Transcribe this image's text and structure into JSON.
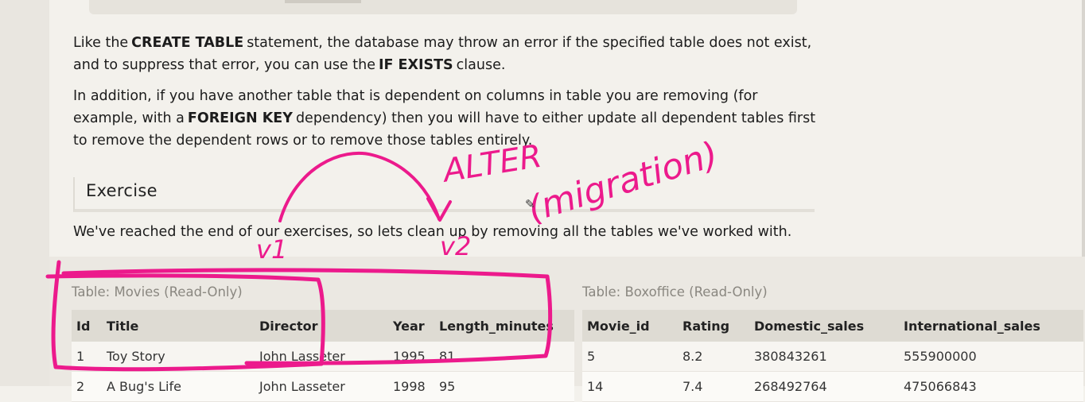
{
  "paragraph1": {
    "t1": "Like the",
    "k1": "CREATE TABLE",
    "t2": "statement, the database may throw an error if the specified table does not exist, and to suppress that error, you can use the",
    "k2": "IF EXISTS",
    "t3": "clause."
  },
  "paragraph2": {
    "t1": "In addition, if you have another table that is dependent on columns in table you are removing (for example, with a",
    "k1": "FOREIGN KEY",
    "t2": "dependency) then you will have to either update all dependent tables first to remove the dependent rows or to remove those tables entirely."
  },
  "exercise": {
    "title": "Exercise",
    "text": "We've reached the end of our exercises, so lets clean up by removing all the tables we've worked with."
  },
  "movies_table": {
    "caption": "Table: Movies (Read-Only)",
    "headers": [
      "Id",
      "Title",
      "Director",
      "Year",
      "Length_minutes"
    ],
    "rows": [
      [
        "1",
        "Toy Story",
        "John Lasseter",
        "1995",
        "81"
      ],
      [
        "2",
        "A Bug's Life",
        "John Lasseter",
        "1998",
        "95"
      ]
    ]
  },
  "boxoffice_table": {
    "caption": "Table: Boxoffice (Read-Only)",
    "headers": [
      "Movie_id",
      "Rating",
      "Domestic_sales",
      "International_sales"
    ],
    "rows": [
      [
        "5",
        "8.2",
        "380843261",
        "555900000"
      ],
      [
        "14",
        "7.4",
        "268492764",
        "475066843"
      ]
    ]
  },
  "annotations": {
    "alter": "ALTER",
    "migration": "(migration)",
    "v1": "v1",
    "v2": "v2",
    "ink_color": "#ec1a8c"
  },
  "cursor_icon": "pen-cursor-icon"
}
